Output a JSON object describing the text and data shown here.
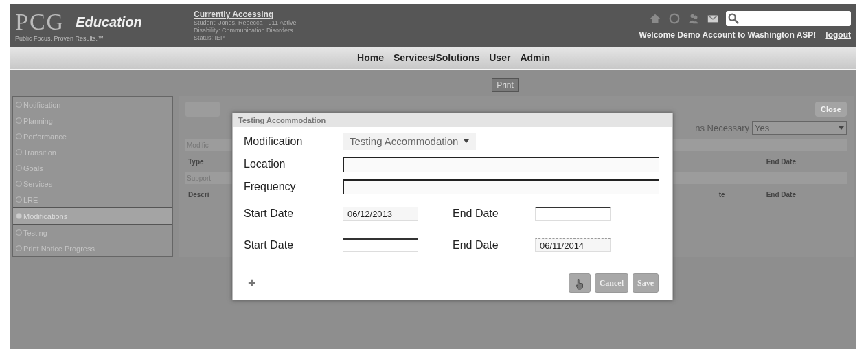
{
  "header": {
    "logo": "PCG",
    "brand": "Education",
    "tagline": "Public Focus. Proven Results.™",
    "accessing_title": "Currently Accessing",
    "accessing_lines": [
      "Student: Jones, Rebecca - 911 Active",
      "Disability: Communication Disorders",
      "Status: IEP"
    ],
    "welcome": "Welcome Demo Account to Washington ASP!",
    "logout": "logout"
  },
  "nav": [
    "Home",
    "Services/Solutions",
    "User",
    "Admin"
  ],
  "tabs": [
    {
      "label": "Print",
      "selected": true
    }
  ],
  "sidebar": [
    {
      "label": "Notification",
      "selected": false
    },
    {
      "label": "Planning",
      "selected": false
    },
    {
      "label": "Performance",
      "selected": false
    },
    {
      "label": "Transition",
      "selected": false
    },
    {
      "label": "Goals",
      "selected": false
    },
    {
      "label": "Services",
      "selected": false
    },
    {
      "label": "LRE",
      "selected": false
    },
    {
      "label": "Modifications",
      "selected": true
    },
    {
      "label": "Testing",
      "selected": false
    },
    {
      "label": "Print Notice Progress",
      "selected": false
    }
  ],
  "content": {
    "close_button": "Close",
    "necessary_label": "ns Necessary",
    "necessary_value": "Yes",
    "mod_heading": "Modific",
    "mod_columns": {
      "left": "Type",
      "right": "End Date"
    },
    "support_heading": "Support",
    "support_columns": {
      "left": "Descri",
      "mid": "te",
      "right": "End Date"
    }
  },
  "dialog": {
    "title": "Testing Accommodation",
    "fields": [
      {
        "kind": "select",
        "label": "Modification",
        "value": "Testing Accommodation"
      },
      {
        "kind": "text",
        "label": "Location"
      },
      {
        "kind": "text",
        "label": "Frequency"
      }
    ],
    "date_rows": [
      {
        "start_label": "Start Date",
        "start": "06/12/2013",
        "end_label": "End Date"
      },
      {
        "start_label": "Start Date",
        "end_label": "End Date",
        "end": "06/11/2014"
      }
    ],
    "add_symbol": "+",
    "buttons": [
      "Cancel",
      "Save"
    ]
  }
}
